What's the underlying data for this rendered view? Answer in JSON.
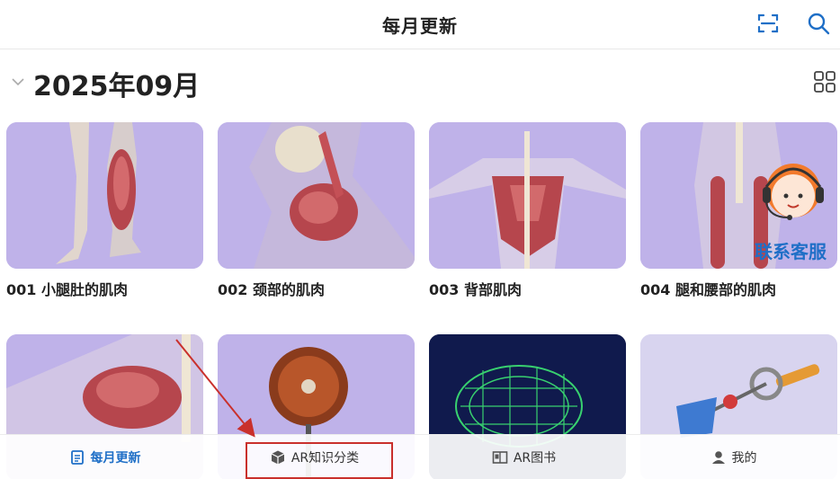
{
  "header": {
    "title": "每月更新",
    "scan_icon": "scan-icon",
    "search_icon": "search-icon"
  },
  "section": {
    "month_label": "2025年09月",
    "collapse_icon": "chevron-down-icon",
    "grid_icon": "grid-view-icon"
  },
  "cards": [
    {
      "caption": "001 小腿肚的肌肉"
    },
    {
      "caption": "002 颈部的肌肉"
    },
    {
      "caption": "003 背部肌肉"
    },
    {
      "caption": "004 腿和腰部的肌肉"
    },
    {
      "caption": ""
    },
    {
      "caption": ""
    },
    {
      "caption": ""
    },
    {
      "caption": ""
    }
  ],
  "service": {
    "label": "联系客服"
  },
  "tabbar": {
    "tabs": [
      {
        "label": "每月更新",
        "icon": "calendar-list-icon",
        "active": true
      },
      {
        "label": "AR知识分类",
        "icon": "cube-icon",
        "active": false
      },
      {
        "label": "AR图书",
        "icon": "book-ar-icon",
        "active": false
      },
      {
        "label": "我的",
        "icon": "user-icon",
        "active": false
      }
    ]
  },
  "colors": {
    "accent": "#1f6fc7",
    "thumb_bg": "#bfb2e9",
    "annotation": "#c9302c"
  }
}
